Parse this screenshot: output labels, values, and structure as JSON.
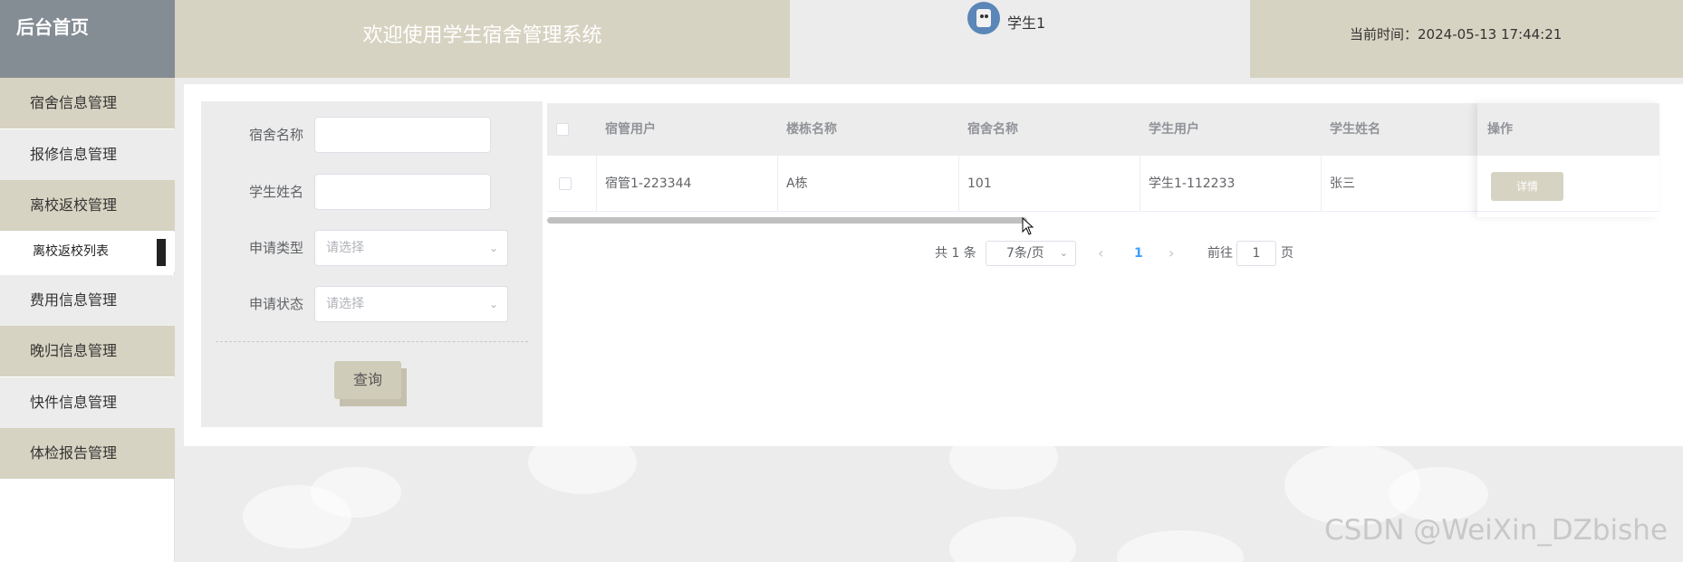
{
  "header": {
    "logo_title": "后台首页",
    "welcome": "欢迎使用学生宿舍管理系统",
    "user_name": "学生1",
    "current_time_label": "当前时间：",
    "current_time": "2024-05-13 17:44:21"
  },
  "sidebar": {
    "items": [
      {
        "label": "宿舍信息管理"
      },
      {
        "label": "报修信息管理"
      },
      {
        "label": "离校返校管理"
      },
      {
        "label": "费用信息管理"
      },
      {
        "label": "晚归信息管理"
      },
      {
        "label": "快件信息管理"
      },
      {
        "label": "体检报告管理"
      }
    ],
    "active_sub_item": "离校返校列表"
  },
  "search": {
    "fields": [
      {
        "label": "宿舍名称",
        "value": ""
      },
      {
        "label": "学生姓名",
        "value": ""
      },
      {
        "label": "申请类型",
        "placeholder": "请选择"
      },
      {
        "label": "申请状态",
        "placeholder": "请选择"
      }
    ],
    "query_button": "查询"
  },
  "table": {
    "columns": [
      "宿管用户",
      "楼栋名称",
      "宿舍名称",
      "学生用户",
      "学生姓名",
      "操作"
    ],
    "rows": [
      {
        "cells": [
          "宿管1-223344",
          "A栋",
          "101",
          "学生1-112233",
          "张三"
        ],
        "action": "详情"
      }
    ]
  },
  "pagination": {
    "total": "共 1 条",
    "page_size": "7条/页",
    "current_page": "1",
    "goto_label": "前往",
    "goto_value": "1",
    "page_suffix": "页"
  },
  "watermark": "CSDN @WeiXin_DZbishe",
  "colors": {
    "tan": "#d7d3c2",
    "grey": "#ececec",
    "slate": "#848c94",
    "link_blue": "#409eff"
  }
}
